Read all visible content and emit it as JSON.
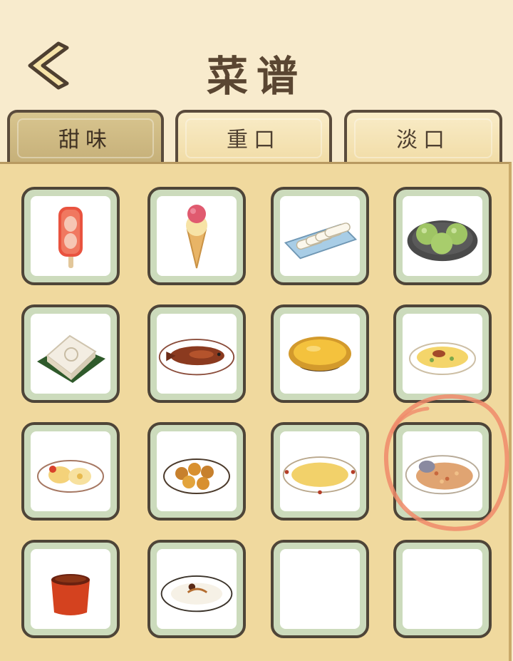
{
  "header": {
    "title": "菜谱",
    "back_icon": "chevron-left-icon"
  },
  "tabs": [
    {
      "label": "甜味",
      "active": true
    },
    {
      "label": "重口",
      "active": false
    },
    {
      "label": "淡口",
      "active": false
    }
  ],
  "recipes": [
    {
      "dish": "strawberry-popsicle"
    },
    {
      "dish": "ice-cream-cone"
    },
    {
      "dish": "rice-rolls"
    },
    {
      "dish": "green-rice-balls"
    },
    {
      "dish": "rice-cake-on-leaf"
    },
    {
      "dish": "braised-fish"
    },
    {
      "dish": "egg-tart"
    },
    {
      "dish": "omelette"
    },
    {
      "dish": "pastries-plate"
    },
    {
      "dish": "glazed-dumplings"
    },
    {
      "dish": "custard-soup"
    },
    {
      "dish": "fried-rice-dish"
    },
    {
      "dish": "jelly-cup"
    },
    {
      "dish": "rice-pudding"
    },
    {
      "dish": "empty-slot"
    },
    {
      "dish": "empty-slot"
    }
  ],
  "colors": {
    "background": "#f8ebcd",
    "panel": "#f0d99e",
    "slot_border": "#4e4538",
    "slot_frame": "#ccdbbc",
    "highlight_circle": "#f08a6a"
  }
}
